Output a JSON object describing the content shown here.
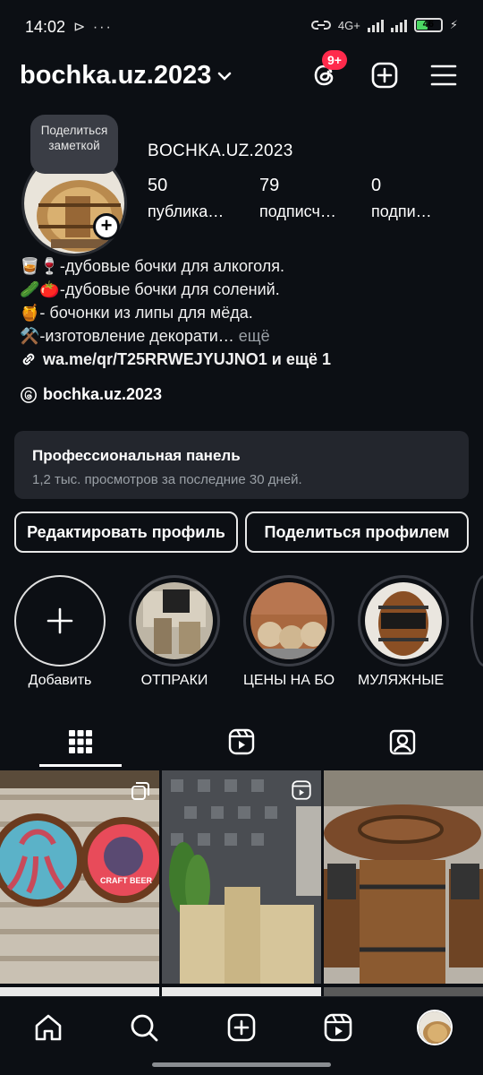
{
  "status_bar": {
    "time": "14:02",
    "left_icons": "⊳ ···",
    "network": "4G+",
    "battery": "46",
    "battery_level": 0.46
  },
  "header": {
    "username": "bochka.uz.2023",
    "notification_badge": "9+",
    "icons": [
      "chevron-down-icon",
      "threads-icon",
      "create-plus-icon",
      "menu-icon"
    ]
  },
  "profile": {
    "note_bubble": "Поделиться заметкой",
    "display_name": "BOCHKA.UZ.2023",
    "stats": [
      {
        "value": "50",
        "label": "публика…"
      },
      {
        "value": "79",
        "label": "подписч…"
      },
      {
        "value": "0",
        "label": "подпи…"
      }
    ],
    "bio": [
      {
        "emoji": "🥃🍷",
        "text": "-дубовые бочки для алкоголя."
      },
      {
        "emoji": "🥒🍅",
        "text": "-дубовые бочки для солений."
      },
      {
        "emoji": "🍯",
        "text": "- бочонки из липы для мёда."
      },
      {
        "emoji": "⚒️",
        "text": "-изготовление декорати…",
        "more": " ещё"
      }
    ],
    "link": "wa.me/qr/T25RRWEJYUJNO1 и ещё 1",
    "threads_handle": "bochka.uz.2023"
  },
  "dashboard": {
    "title": "Профессиональная панель",
    "subtitle": "1,2 тыс. просмотров за последние 30 дней."
  },
  "buttons": {
    "edit_profile": "Редактировать профиль",
    "share_profile": "Поделиться профилем"
  },
  "highlights": [
    {
      "label": "Добавить"
    },
    {
      "label": "ОТПРАКИ"
    },
    {
      "label": "ЦЕНЫ НА БО…"
    },
    {
      "label": "МУЛЯЖНЫЕ …"
    }
  ],
  "tabs": [
    "grid-icon",
    "reels-icon",
    "tagged-icon"
  ],
  "posts": [
    {
      "type": "carousel",
      "label": "CRAFT BEER"
    },
    {
      "type": "reel"
    },
    {
      "type": "photo"
    }
  ],
  "bottom_nav": [
    "home-icon",
    "search-icon",
    "create-icon",
    "reels-icon",
    "profile-avatar"
  ],
  "colors": {
    "background": "#0c0f14",
    "badge": "#ff2a4c",
    "panel": "#23262d"
  }
}
